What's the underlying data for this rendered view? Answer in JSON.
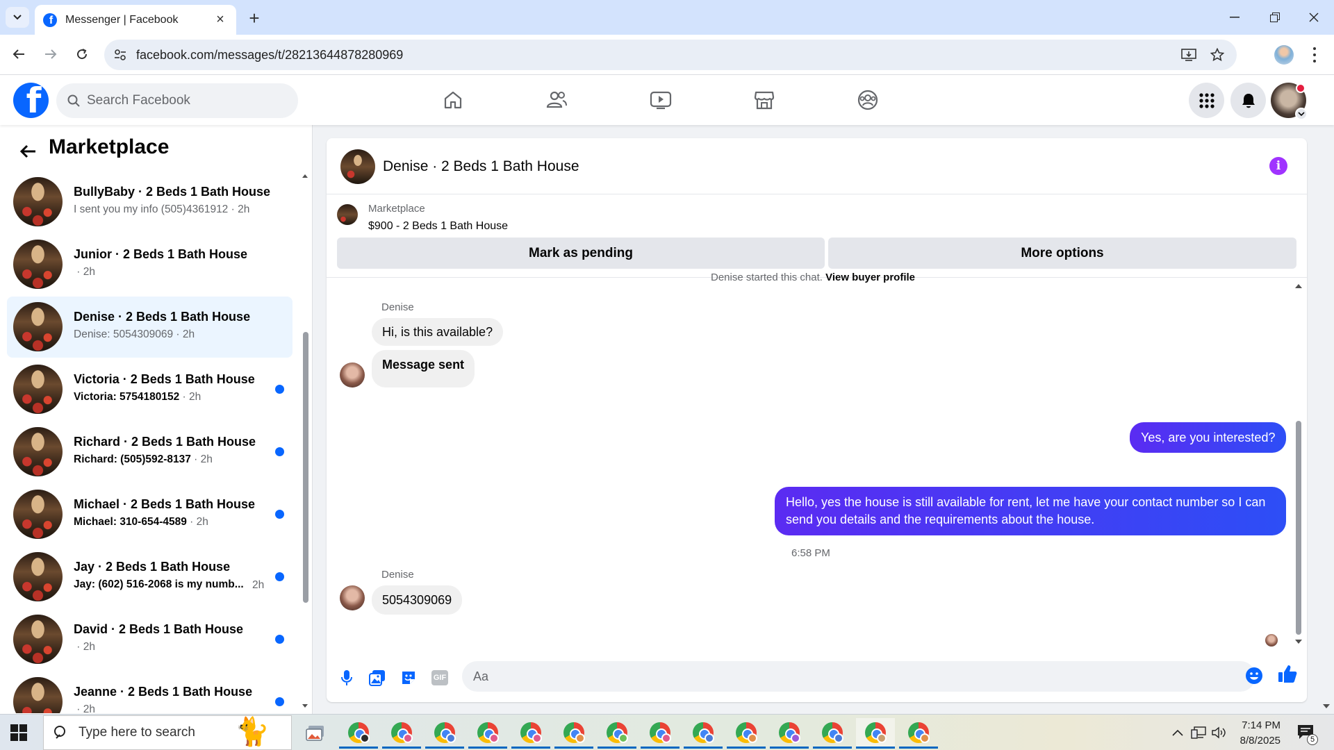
{
  "browser": {
    "tab_title": "Messenger | Facebook",
    "url": "facebook.com/messages/t/28213644878280969"
  },
  "header": {
    "search_placeholder": "Search Facebook"
  },
  "sidebar": {
    "title": "Marketplace",
    "conversations": [
      {
        "name": "BullyBaby · 2 Beds 1 Bath House",
        "preview": "I sent you my info (505)4361912",
        "time": "2h",
        "unread": false,
        "active": false
      },
      {
        "name": "Junior · 2 Beds 1 Bath House",
        "preview": "",
        "time": "2h",
        "unread": false,
        "active": false
      },
      {
        "name": "Denise · 2 Beds 1 Bath House",
        "preview": "Denise: 5054309069",
        "time": "2h",
        "unread": false,
        "active": true
      },
      {
        "name": "Victoria · 2 Beds 1 Bath House",
        "preview": "Victoria: 5754180152",
        "time": "2h",
        "unread": true,
        "active": false
      },
      {
        "name": "Richard · 2 Beds 1 Bath House",
        "preview": "Richard: (505)592-8137",
        "time": "2h",
        "unread": true,
        "active": false
      },
      {
        "name": "Michael · 2 Beds 1 Bath House",
        "preview": "Michael: 310-654-4589",
        "time": "2h",
        "unread": true,
        "active": false
      },
      {
        "name": "Jay · 2 Beds 1 Bath House",
        "preview": "Jay: (602) 516-2068 is my numb...",
        "time": "2h",
        "unread": true,
        "active": false
      },
      {
        "name": "David · 2 Beds 1 Bath House",
        "preview": "",
        "time": "2h",
        "unread": true,
        "active": false
      },
      {
        "name": "Jeanne · 2 Beds 1 Bath House",
        "preview": "",
        "time": "2h",
        "unread": true,
        "active": false
      }
    ]
  },
  "chat": {
    "title": "Denise · 2 Beds 1 Bath House",
    "listing": {
      "label": "Marketplace",
      "title": "$900 - 2 Beds 1 Bath House",
      "mark_pending": "Mark as pending",
      "more_options": "More options"
    },
    "started_text": "Denise started this chat.",
    "view_profile": "View buyer profile",
    "messages": {
      "sender1": "Denise",
      "in1": "Hi, is this available?",
      "in2": "Message sent",
      "out1": "Yes, are you interested?",
      "out2": "Hello, yes the house is still available for rent, let me have your contact number so I can send you details and the requirements about the house.",
      "timestamp": "6:58 PM",
      "sender2": "Denise",
      "in3": "5054309069"
    },
    "composer_placeholder": "Aa"
  },
  "taskbar": {
    "search_placeholder": "Type here to search",
    "time": "7:14 PM",
    "date": "8/8/2025",
    "notification_count": "5",
    "app_badge_colors": [
      "#2b2b2b",
      "#e05a8a",
      "#4a7bd8",
      "#e05a8a",
      "#e05a8a",
      "#e0904a",
      "#6bbf59",
      "#e05a8a",
      "#4a7bd8",
      "#e0904a",
      "#9a5ad8",
      "#4a7bd8",
      "#c8a070",
      "#e0904a"
    ]
  },
  "colors": {
    "facebook_blue": "#0866ff",
    "outgoing_bubble": "#5b2bf2",
    "info_purple": "#a033ff"
  }
}
